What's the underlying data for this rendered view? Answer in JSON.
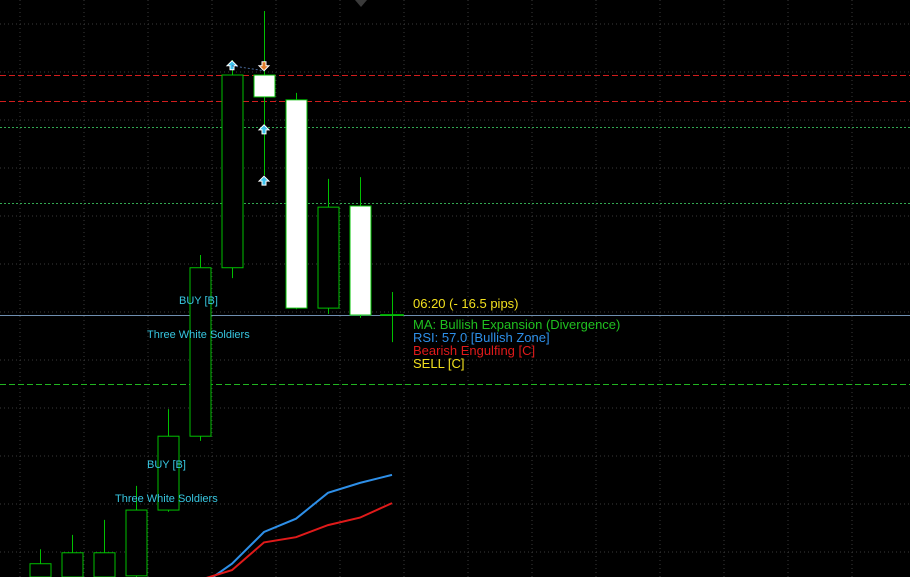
{
  "colors": {
    "background": "#000000",
    "grid": "#3a3a3a",
    "candle_outline": "#00c000",
    "bull_body": "#000000",
    "bear_body": "#ffffff",
    "price_line": "#6f8fb0",
    "resistance": "#d11d1d",
    "target": "#32a852",
    "support": "#21b521",
    "ma_fast": "#2e8fe8",
    "ma_slow": "#e01a1a",
    "signal_text": "#37c6e0",
    "timer_text": "#f2e01e",
    "ma_text": "#20c020",
    "rsi_text": "#2e8fe8",
    "pattern_text": "#e01a1a",
    "sell_text": "#f2e01e",
    "buy_arrow": "#3ec2ec",
    "sell_arrow": "#e07b2a"
  },
  "icons": {
    "top_marker": "triangle-down-icon",
    "buy_marker": "arrow-up-icon",
    "sell_marker": "arrow-down-icon",
    "current_bar": "crosshair-icon"
  },
  "info_panel": {
    "timer": "06:20 (- 16.5 pips)",
    "ma": "MA: Bullish Expansion (Divergence)",
    "rsi": "RSI: 57.0 [Bullish Zone]",
    "pattern": "Bearish Engulfing [C]",
    "signal": "SELL [C]"
  },
  "signals": {
    "buy_upper": "BUY [B]",
    "pattern_upper": "Three White Soldiers",
    "buy_lower": "BUY [B]",
    "pattern_lower": "Three White Soldiers"
  },
  "chart_data": {
    "type": "candlestick",
    "title": "",
    "xlabel": "",
    "ylabel": "",
    "y_units": "relative price (0 = bottom of visible area, 100 = top)",
    "ylim": [
      0,
      100
    ],
    "grid": true,
    "candles": [
      {
        "open": 0,
        "high": 4.8,
        "low": 0,
        "close": 2.3,
        "dir": "bull"
      },
      {
        "open": 0,
        "high": 7.3,
        "low": 0,
        "close": 4.2,
        "dir": "bull"
      },
      {
        "open": 0,
        "high": 9.9,
        "low": 0,
        "close": 4.2,
        "dir": "bull"
      },
      {
        "open": 0.2,
        "high": 15.8,
        "low": 0,
        "close": 11.6,
        "dir": "bull"
      },
      {
        "open": 11.6,
        "high": 29.1,
        "low": 11.3,
        "close": 24.4,
        "dir": "bull"
      },
      {
        "open": 24.4,
        "high": 55.8,
        "low": 23.6,
        "close": 53.6,
        "dir": "bull"
      },
      {
        "open": 53.6,
        "high": 89.6,
        "low": 51.8,
        "close": 87.0,
        "dir": "bull"
      },
      {
        "open": 87.0,
        "high": 98.1,
        "low": 69.6,
        "close": 83.2,
        "dir": "bear"
      },
      {
        "open": 82.7,
        "high": 83.9,
        "low": 46.4,
        "close": 46.6,
        "dir": "bear"
      },
      {
        "open": 64.1,
        "high": 69.0,
        "low": 45.6,
        "close": 46.6,
        "dir": "bull"
      },
      {
        "open": 64.3,
        "high": 69.3,
        "low": 44.9,
        "close": 45.4,
        "dir": "bear"
      },
      {
        "open": 45.4,
        "high": 49.4,
        "low": 40.7,
        "close": 45.4,
        "dir": "doji"
      }
    ],
    "levels": [
      {
        "name": "resistance-1",
        "y": 87.0,
        "style": "dashed",
        "color_key": "resistance"
      },
      {
        "name": "resistance-2",
        "y": 82.5,
        "style": "dashed",
        "color_key": "resistance"
      },
      {
        "name": "target-1",
        "y": 78.0,
        "style": "dotted",
        "color_key": "target"
      },
      {
        "name": "target-2",
        "y": 64.9,
        "style": "dotted",
        "color_key": "target"
      },
      {
        "name": "current-price",
        "y": 45.4,
        "style": "solid",
        "color_key": "price_line"
      },
      {
        "name": "support-1",
        "y": 33.4,
        "style": "dashed",
        "color_key": "support"
      }
    ],
    "series": [
      {
        "values": [
          null,
          null,
          null,
          null,
          null,
          -1.6,
          2.3,
          7.8,
          10.1,
          14.6,
          16.3,
          17.7
        ]
      },
      {
        "values": [
          null,
          null,
          null,
          null,
          null,
          -0.5,
          1.2,
          6.0,
          6.9,
          9.0,
          10.3,
          12.8
        ]
      }
    ],
    "markers": [
      {
        "bar": 6,
        "y": 88.6,
        "type": "buy"
      },
      {
        "bar": 7,
        "y": 88.6,
        "type": "sell"
      },
      {
        "bar": 7,
        "y": 77.5,
        "type": "buy"
      },
      {
        "bar": 7,
        "y": 68.6,
        "type": "buy"
      }
    ]
  }
}
